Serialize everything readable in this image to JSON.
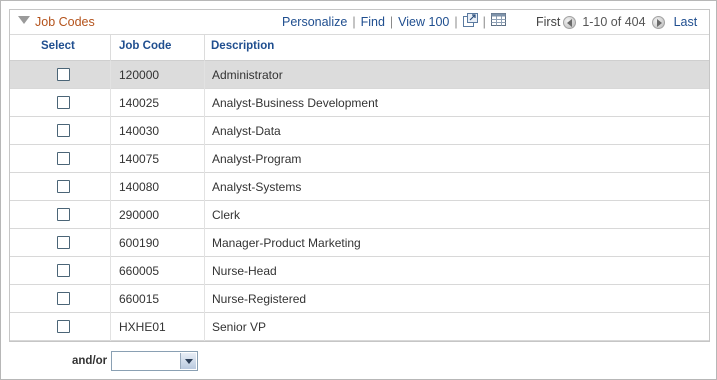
{
  "grid": {
    "title": "Job Codes",
    "links": {
      "personalize": "Personalize",
      "find": "Find",
      "view_all": "View 100"
    },
    "paging": {
      "first": "First",
      "range": "1-10 of 404",
      "last": "Last"
    },
    "columns": {
      "select": "Select",
      "job_code": "Job Code",
      "description": "Description"
    },
    "rows": [
      {
        "code": "120000",
        "description": "Administrator",
        "selected": true
      },
      {
        "code": "140025",
        "description": "Analyst-Business Development",
        "selected": false
      },
      {
        "code": "140030",
        "description": "Analyst-Data",
        "selected": false
      },
      {
        "code": "140075",
        "description": "Analyst-Program",
        "selected": false
      },
      {
        "code": "140080",
        "description": "Analyst-Systems",
        "selected": false
      },
      {
        "code": "290000",
        "description": "Clerk",
        "selected": false
      },
      {
        "code": "600190",
        "description": "Manager-Product Marketing",
        "selected": false
      },
      {
        "code": "660005",
        "description": "Nurse-Head",
        "selected": false
      },
      {
        "code": "660015",
        "description": "Nurse-Registered",
        "selected": false
      },
      {
        "code": "HXHE01",
        "description": "Senior VP",
        "selected": false
      }
    ]
  },
  "filter": {
    "andor_label": "and/or",
    "andor_value": ""
  },
  "colors": {
    "title": "#b4531c",
    "link": "#1f4e8f",
    "selected_row": "#dcdcdc"
  },
  "icons": [
    "collapse-arrow-icon",
    "new-window-icon",
    "download-grid-icon",
    "prev-page-icon",
    "next-page-icon",
    "dropdown-arrow-icon"
  ]
}
